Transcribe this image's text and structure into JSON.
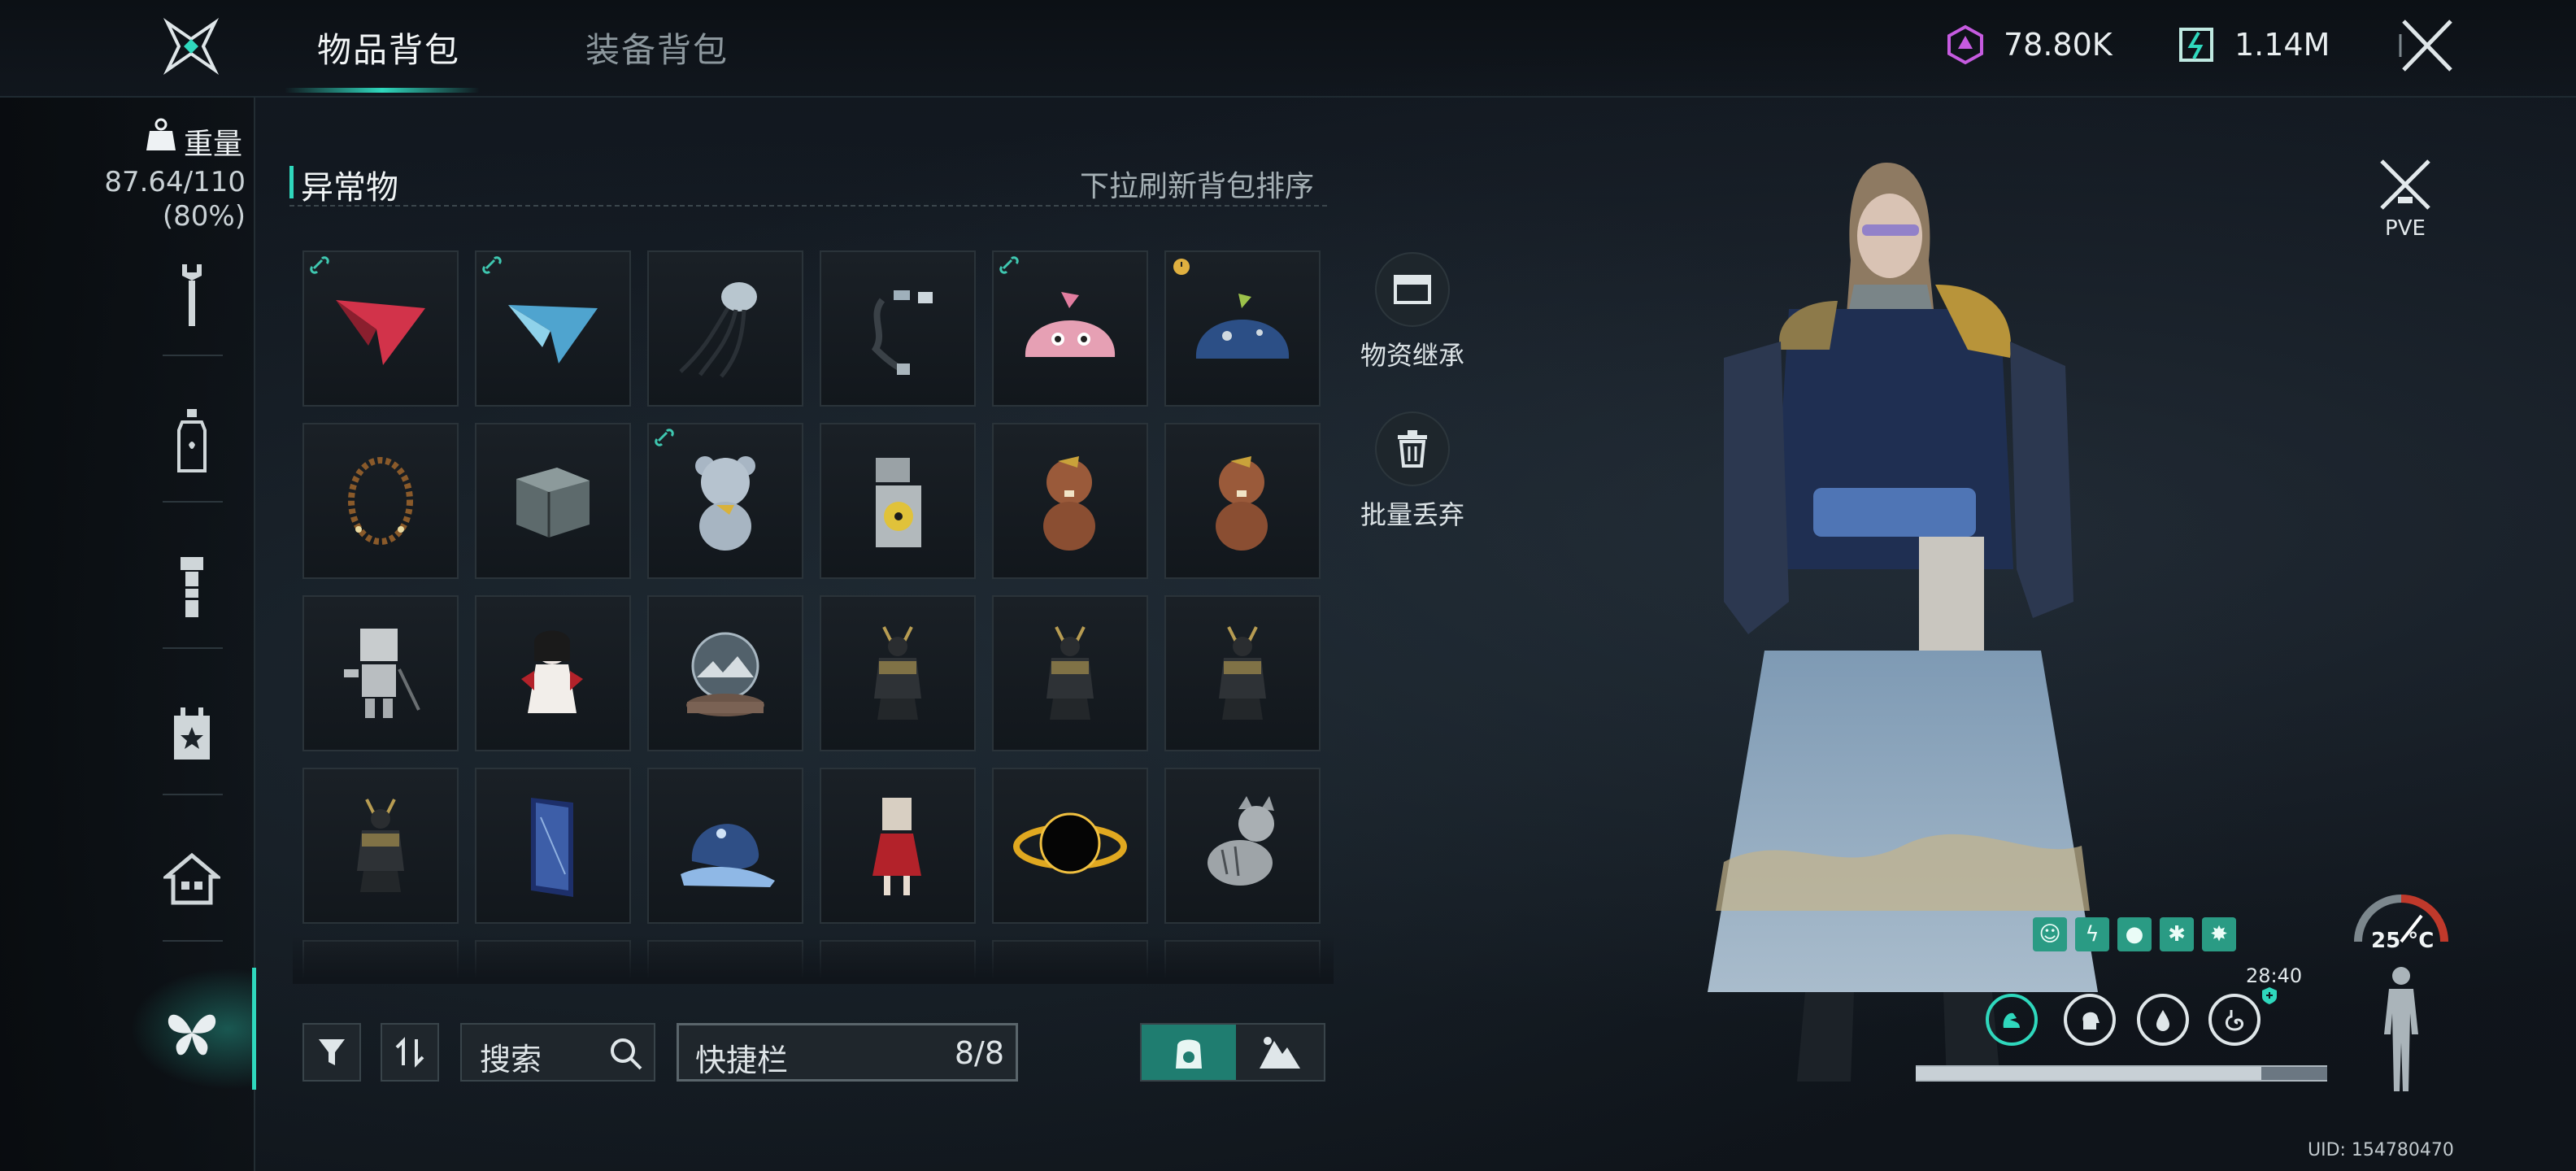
{
  "header": {
    "tabs": [
      {
        "label": "物品背包",
        "active": true
      },
      {
        "label": "装备背包",
        "active": false
      }
    ],
    "currencies": [
      {
        "icon": "purple-crystal-icon",
        "value": "78.80K",
        "color": "#c65be0"
      },
      {
        "icon": "teal-energy-icon",
        "value": "1.14M",
        "color": "#2fd8bd"
      }
    ]
  },
  "sidebar": {
    "weight_title": "重量",
    "weight_value": "87.64/110",
    "weight_percent": "(80%)",
    "items": [
      {
        "icon": "wrench-icon"
      },
      {
        "icon": "bottle-icon"
      },
      {
        "icon": "flashlight-icon"
      },
      {
        "icon": "star-box-icon"
      },
      {
        "icon": "house-icon"
      },
      {
        "icon": "butterfly-icon",
        "active": true
      }
    ]
  },
  "section": {
    "title": "异常物",
    "hint": "下拉刷新背包排序"
  },
  "inventory": {
    "items": [
      {
        "name": "red-paper-plane",
        "tag": "link"
      },
      {
        "name": "blue-paper-plane",
        "tag": "link"
      },
      {
        "name": "jellyfish",
        "tag": ""
      },
      {
        "name": "hanging-chain",
        "tag": ""
      },
      {
        "name": "pink-slime",
        "tag": "link"
      },
      {
        "name": "blue-slime",
        "tag": "timer"
      },
      {
        "name": "bead-necklace",
        "tag": ""
      },
      {
        "name": "metal-cube",
        "tag": ""
      },
      {
        "name": "knit-bear",
        "tag": "link"
      },
      {
        "name": "radiation-lighter",
        "tag": ""
      },
      {
        "name": "knit-beaver-1",
        "tag": ""
      },
      {
        "name": "knit-beaver-2",
        "tag": ""
      },
      {
        "name": "box-robot",
        "tag": ""
      },
      {
        "name": "red-doll",
        "tag": ""
      },
      {
        "name": "snow-globe",
        "tag": ""
      },
      {
        "name": "samurai-armor-1",
        "tag": ""
      },
      {
        "name": "samurai-armor-2",
        "tag": ""
      },
      {
        "name": "samurai-armor-3",
        "tag": ""
      },
      {
        "name": "samurai-armor-4",
        "tag": ""
      },
      {
        "name": "mirror-door",
        "tag": ""
      },
      {
        "name": "crystal-snail",
        "tag": ""
      },
      {
        "name": "paper-bag-doll",
        "tag": ""
      },
      {
        "name": "black-hole",
        "tag": ""
      },
      {
        "name": "tabby-cat",
        "tag": ""
      }
    ]
  },
  "actions": {
    "inherit_label": "物资继承",
    "discard_label": "批量丢弃"
  },
  "toolbar": {
    "search_label": "搜索",
    "quickbar_label": "快捷栏",
    "quickbar_count": "8/8"
  },
  "character": {
    "mode_label": "PVE",
    "temperature": "25 °C",
    "buff_timer": "28:40",
    "stamina_fraction": 0.84,
    "uid": "UID: 154780470",
    "status_icons": [
      "cat-icon",
      "lung-icon",
      "drop-icon",
      "bug-icon",
      "burst-icon"
    ],
    "vital_rings": [
      "muscle-icon",
      "head-icon",
      "water-icon",
      "stomach-icon"
    ]
  }
}
